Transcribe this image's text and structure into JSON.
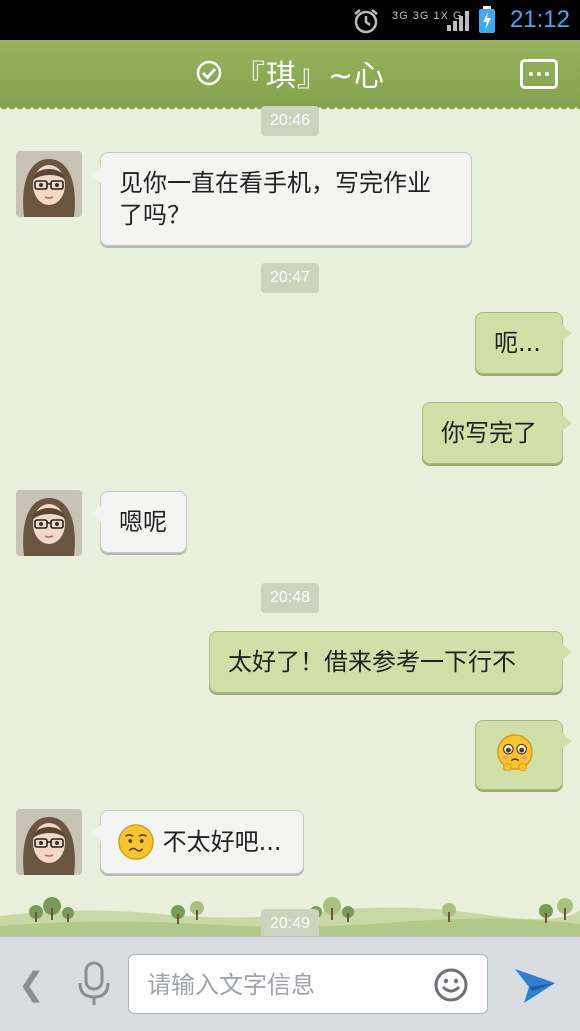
{
  "status_bar": {
    "network": "3G 3G 1X G",
    "time": "21:12"
  },
  "header": {
    "title": "『琪』~心",
    "more_icon": "more-dots-icon",
    "status_icon": "check-circle-icon"
  },
  "messages": [
    {
      "type": "timestamp",
      "text": "20:46"
    },
    {
      "type": "incoming",
      "text": "见你一直在看手机，写完作业了吗？"
    },
    {
      "type": "timestamp",
      "text": "20:47"
    },
    {
      "type": "outgoing",
      "text": "呃..."
    },
    {
      "type": "outgoing",
      "text": "你写完了"
    },
    {
      "type": "incoming",
      "text": "嗯呢"
    },
    {
      "type": "timestamp",
      "text": "20:48"
    },
    {
      "type": "outgoing",
      "text": "太好了！借来参考一下行不"
    },
    {
      "type": "outgoing",
      "emoji": "pleading-face-emoji"
    },
    {
      "type": "incoming",
      "emoji": "worried-face-emoji",
      "text": "不太好吧..."
    },
    {
      "type": "timestamp",
      "text": "20:49"
    }
  ],
  "input_bar": {
    "placeholder": "请输入文字信息",
    "value": ""
  },
  "colors": {
    "header": "#8dab55",
    "background": "#e9f0dc",
    "outgoing_bubble": "#cfe0a8",
    "incoming_bubble": "#f4f4f2",
    "time": "#3fa9f5"
  }
}
